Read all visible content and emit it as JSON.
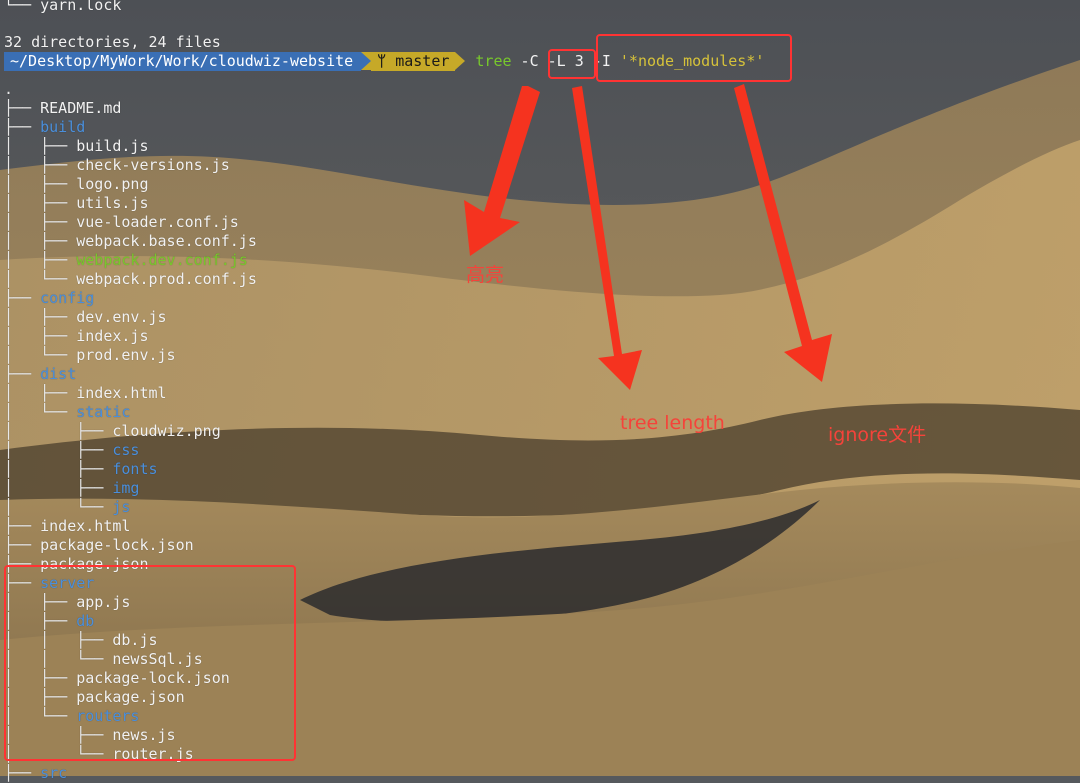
{
  "terminal": {
    "top_line": "└── yarn.lock",
    "summary": "32 directories, 24 files",
    "prompt": {
      "path": "~/Desktop/MyWork/Work/cloudwiz-website",
      "branch_icon": "git-branch-icon",
      "branch": "master",
      "command_word": "tree",
      "args": " -C -L 3 -I ",
      "pattern": "'*node_modules*'"
    },
    "tree": [
      {
        "prefix": ".",
        "name": "",
        "type": "root"
      },
      {
        "prefix": "├── ",
        "name": "README.md",
        "type": "file"
      },
      {
        "prefix": "├── ",
        "name": "build",
        "type": "dir"
      },
      {
        "prefix": "│   ├── ",
        "name": "build.js",
        "type": "file"
      },
      {
        "prefix": "│   ├── ",
        "name": "check-versions.js",
        "type": "file"
      },
      {
        "prefix": "│   ├── ",
        "name": "logo.png",
        "type": "file"
      },
      {
        "prefix": "│   ├── ",
        "name": "utils.js",
        "type": "file"
      },
      {
        "prefix": "│   ├── ",
        "name": "vue-loader.conf.js",
        "type": "file"
      },
      {
        "prefix": "│   ├── ",
        "name": "webpack.base.conf.js",
        "type": "file"
      },
      {
        "prefix": "│   ├── ",
        "name": "webpack.dev.conf.js",
        "type": "highlight"
      },
      {
        "prefix": "│   └── ",
        "name": "webpack.prod.conf.js",
        "type": "file"
      },
      {
        "prefix": "├── ",
        "name": "config",
        "type": "dir"
      },
      {
        "prefix": "│   ├── ",
        "name": "dev.env.js",
        "type": "file"
      },
      {
        "prefix": "│   ├── ",
        "name": "index.js",
        "type": "file"
      },
      {
        "prefix": "│   └── ",
        "name": "prod.env.js",
        "type": "file"
      },
      {
        "prefix": "├── ",
        "name": "dist",
        "type": "dir"
      },
      {
        "prefix": "│   ├── ",
        "name": "index.html",
        "type": "file"
      },
      {
        "prefix": "│   └── ",
        "name": "static",
        "type": "dir"
      },
      {
        "prefix": "│       ├── ",
        "name": "cloudwiz.png",
        "type": "file"
      },
      {
        "prefix": "│       ├── ",
        "name": "css",
        "type": "dir"
      },
      {
        "prefix": "│       ├── ",
        "name": "fonts",
        "type": "dir"
      },
      {
        "prefix": "│       ├── ",
        "name": "img",
        "type": "dir"
      },
      {
        "prefix": "│       └── ",
        "name": "js",
        "type": "dir"
      },
      {
        "prefix": "├── ",
        "name": "index.html",
        "type": "file"
      },
      {
        "prefix": "├── ",
        "name": "package-lock.json",
        "type": "file"
      },
      {
        "prefix": "├── ",
        "name": "package.json",
        "type": "file"
      },
      {
        "prefix": "├── ",
        "name": "server",
        "type": "dir"
      },
      {
        "prefix": "│   ├── ",
        "name": "app.js",
        "type": "file"
      },
      {
        "prefix": "│   ├── ",
        "name": "db",
        "type": "dir"
      },
      {
        "prefix": "│   │   ├── ",
        "name": "db.js",
        "type": "file"
      },
      {
        "prefix": "│   │   └── ",
        "name": "newsSql.js",
        "type": "file"
      },
      {
        "prefix": "│   ├── ",
        "name": "package-lock.json",
        "type": "file"
      },
      {
        "prefix": "│   ├── ",
        "name": "package.json",
        "type": "file"
      },
      {
        "prefix": "│   └── ",
        "name": "routers",
        "type": "dir"
      },
      {
        "prefix": "│       ├── ",
        "name": "news.js",
        "type": "file"
      },
      {
        "prefix": "│       └── ",
        "name": "router.js",
        "type": "file"
      },
      {
        "prefix": "├── ",
        "name": "src",
        "type": "dir"
      }
    ]
  },
  "annotations": {
    "highlight_label": "高亮",
    "length_label": "tree length",
    "ignore_label": "ignore文件"
  },
  "colors": {
    "annotation_red": "#f5433a",
    "directory_blue": "#4a8fdc",
    "highlight_green": "#78c82c",
    "prompt_path_bg": "#3a6fb5",
    "prompt_branch_bg": "#c6a928"
  }
}
